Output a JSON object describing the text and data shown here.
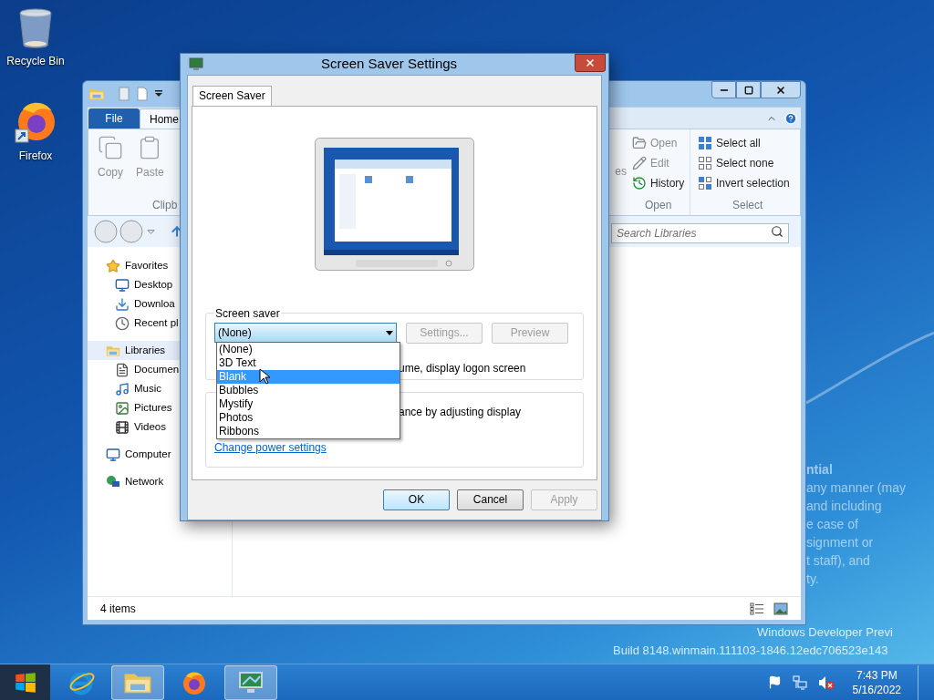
{
  "desktop": {
    "icons": [
      {
        "kind": "recycle-bin",
        "label": "Recycle Bin"
      },
      {
        "kind": "firefox",
        "label": "Firefox"
      }
    ],
    "notice_lines": [
      "ntial",
      "any manner (may",
      "and including",
      "e case of",
      "signment or",
      "t staff), and",
      "ty."
    ],
    "build_lines": [
      "Windows Developer Previ",
      "Build 8148.winmain.111103-1846.12edc706523e143"
    ]
  },
  "explorer": {
    "file_tab": "File",
    "tabs": [
      {
        "label": "Home",
        "selected": true
      }
    ],
    "clipboard_buttons": [
      {
        "kind": "copy",
        "label": "Copy",
        "disabled": true
      },
      {
        "kind": "paste",
        "label": "Paste",
        "disabled": true
      }
    ],
    "clipboard_group": "Clipb",
    "properties_fragment": "es",
    "open_buttons": [
      {
        "kind": "open",
        "label": "Open",
        "disabled": true
      },
      {
        "kind": "edit",
        "label": "Edit",
        "disabled": true
      },
      {
        "kind": "history",
        "label": "History",
        "disabled": false
      }
    ],
    "open_group": "Open",
    "select_buttons": [
      {
        "kind": "select-all",
        "label": "Select all"
      },
      {
        "kind": "select-none",
        "label": "Select none"
      },
      {
        "kind": "invert",
        "label": "Invert selection"
      }
    ],
    "select_group": "Select",
    "search": {
      "placeholder": "Search Libraries"
    },
    "nav": [
      {
        "kind": "favorites",
        "label": "Favorites",
        "selected": false,
        "children": [
          {
            "kind": "desktop",
            "label": "Desktop",
            "selected": false
          },
          {
            "kind": "downloads",
            "label": "Downloa",
            "selected": false
          },
          {
            "kind": "recent",
            "label": "Recent pl",
            "selected": false
          }
        ]
      },
      {
        "kind": "libraries",
        "label": "Libraries",
        "selected": true,
        "children": [
          {
            "kind": "documents",
            "label": "Documen",
            "selected": false
          },
          {
            "kind": "music",
            "label": "Music",
            "selected": false
          },
          {
            "kind": "pictures",
            "label": "Pictures",
            "selected": false
          },
          {
            "kind": "videos",
            "label": "Videos",
            "selected": false
          }
        ]
      },
      {
        "kind": "computer",
        "label": "Computer",
        "selected": false
      },
      {
        "kind": "network",
        "label": "Network",
        "selected": false
      }
    ],
    "status": "4 items"
  },
  "dialog": {
    "title": "Screen Saver Settings",
    "tabs": [
      {
        "label": "Screen Saver",
        "selected": true
      }
    ],
    "group_label": "Screen saver",
    "combo_value": "(None)",
    "buttons": [
      {
        "label": "Settings...",
        "disabled": true
      },
      {
        "label": "Preview",
        "disabled": true
      }
    ],
    "options": [
      {
        "label": "(None)",
        "selected": false
      },
      {
        "label": "3D Text",
        "selected": false
      },
      {
        "label": "Blank",
        "selected": true
      },
      {
        "label": "Bubbles",
        "selected": false
      },
      {
        "label": "Mystify",
        "selected": false
      },
      {
        "label": "Photos",
        "selected": false
      },
      {
        "label": "Ribbons",
        "selected": false
      }
    ],
    "logon_text": "ume, display logon screen",
    "power_text": "ance by adjusting display",
    "power_link": "Change power settings",
    "footer_buttons": [
      {
        "label": "OK",
        "kind": "default",
        "disabled": false
      },
      {
        "label": "Cancel",
        "kind": "normal",
        "disabled": false
      },
      {
        "label": "Apply",
        "kind": "normal",
        "disabled": true
      }
    ]
  },
  "taskbar": {
    "apps": [
      {
        "kind": "ie",
        "active": false
      },
      {
        "kind": "explorer",
        "active": true
      },
      {
        "kind": "firefox",
        "active": false
      },
      {
        "kind": "display",
        "active": true
      }
    ],
    "time": "7:43 PM",
    "date": "5/16/2022"
  }
}
